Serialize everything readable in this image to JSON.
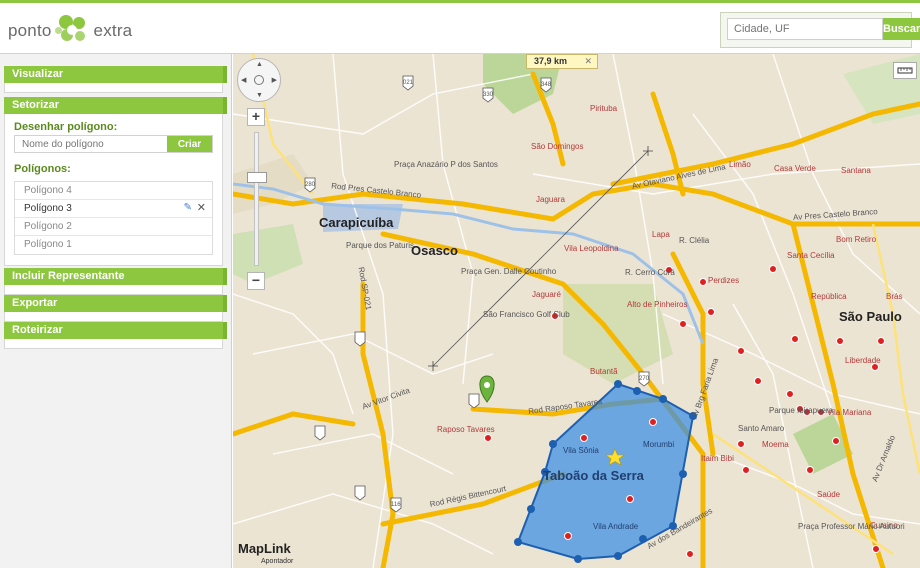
{
  "header": {
    "logo_word_1": "ponto",
    "logo_word_2": "extra",
    "search_placeholder": "Cidade, UF",
    "search_button": "Buscar"
  },
  "sidebar": {
    "panels": [
      {
        "title": "Visualizar"
      },
      {
        "title": "Setorizar"
      },
      {
        "title": "Incluir Representante"
      },
      {
        "title": "Exportar"
      },
      {
        "title": "Roteirizar"
      }
    ],
    "setorizar": {
      "draw_label": "Desenhar polígono:",
      "name_placeholder": "Nome do polígono",
      "create_button": "Criar",
      "list_label": "Polígonos:",
      "polygons": [
        {
          "name": "Polígono 4"
        },
        {
          "name": "Polígono 3"
        },
        {
          "name": "Polígono 2"
        },
        {
          "name": "Polígono 1"
        }
      ]
    }
  },
  "map": {
    "measure_label": "37,9 km",
    "measure_close": "✕",
    "brand": "MapLink",
    "brand_sub": "Apontador",
    "pan_icon": "pan-compass-icon",
    "zoom_in": "+",
    "zoom_out": "−",
    "accent_color": "#8dc63f",
    "polygon_color": "#3a8ee6",
    "cities": [
      "Carapicuíba",
      "Osasco",
      "São Paulo"
    ],
    "polygon_name": "Taboão da Serra",
    "polygon_districts": [
      "Vila Sônia",
      "Morumbi",
      "Vila Andrade"
    ],
    "districts": [
      "Pirituba",
      "São Domingos",
      "Jaguara",
      "Limão",
      "Casa Verde",
      "Santana",
      "Vila Leopoldina",
      "Lapa",
      "R. Clélia",
      "Bom Retiro",
      "Santa Cecília",
      "Perdizes",
      "República",
      "Brás",
      "Jaguaré",
      "R. Cerro Corá",
      "Alto de Pinheiros",
      "Liberdade",
      "Butantã",
      "Parque Ibirapuera",
      "Vila Mariana",
      "Moema",
      "Itaim Bibi",
      "Santo Amaro",
      "Saúde",
      "Cursino",
      "Praça Professor Mário Autuori",
      "Raposo Tavares",
      "Parque dos Paturis",
      "Praça Anazário P dos Santos",
      "Praça Gen. Dalle Coutinho",
      "São Francisco Golf Club"
    ],
    "roads": [
      "Rod Pres Castelo Branco",
      "Av Otaviano Alves de Lima",
      "Av Pres Castelo Branco",
      "Rod Raposo Tavares",
      "Rod Régis Bittencourt",
      "Av Vitor Civita",
      "Rod SP-021",
      "Av dos Bandeirantes",
      "Av Brg Faria Lima",
      "Av Dr Arnaldo"
    ],
    "highway_shields": [
      "021",
      "330",
      "348",
      "280",
      "270",
      "116"
    ]
  }
}
